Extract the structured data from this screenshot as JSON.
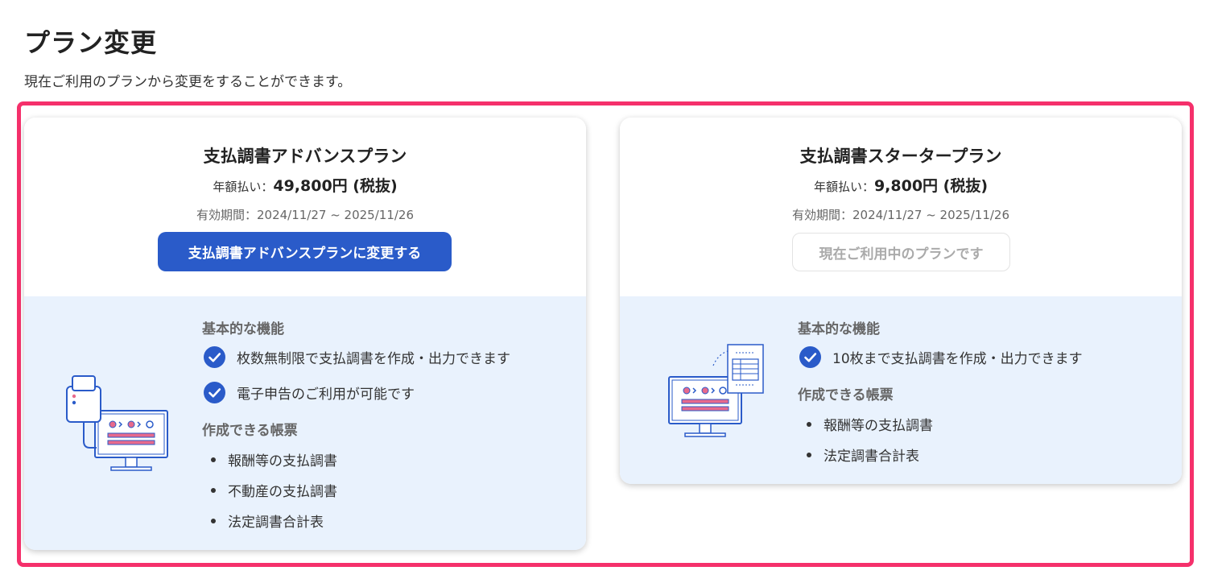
{
  "page": {
    "title": "プラン変更",
    "description": "現在ご利用のプランから変更をすることができます。"
  },
  "colors": {
    "accent": "#2a5bc9",
    "highlight_border": "#f5306b",
    "feature_bg": "#e9f2fd"
  },
  "plans": [
    {
      "name": "支払調書アドバンスプラン",
      "price_label": "年額払い：",
      "price_value": "49,800円 (税抜)",
      "period": "有効期間：2024/11/27 ~ 2025/11/26",
      "action_label": "支払調書アドバンスプランに変更する",
      "is_current": false,
      "features_heading": "基本的な機能",
      "features": [
        "枚数無制限で支払調書を作成・出力できます",
        "電子申告のご利用が可能です"
      ],
      "forms_heading": "作成できる帳票",
      "forms": [
        "報酬等の支払調書",
        "不動産の支払調書",
        "法定調書合計表"
      ],
      "illustration_icon": "printer-monitor-icon"
    },
    {
      "name": "支払調書スタータープラン",
      "price_label": "年額払い：",
      "price_value": "9,800円 (税抜)",
      "period": "有効期間：2024/11/27 ~ 2025/11/26",
      "action_label": "現在ご利用中のプランです",
      "is_current": true,
      "features_heading": "基本的な機能",
      "features": [
        "10枚まで支払調書を作成・出力できます"
      ],
      "forms_heading": "作成できる帳票",
      "forms": [
        "報酬等の支払調書",
        "法定調書合計表"
      ],
      "illustration_icon": "document-monitor-icon"
    }
  ]
}
